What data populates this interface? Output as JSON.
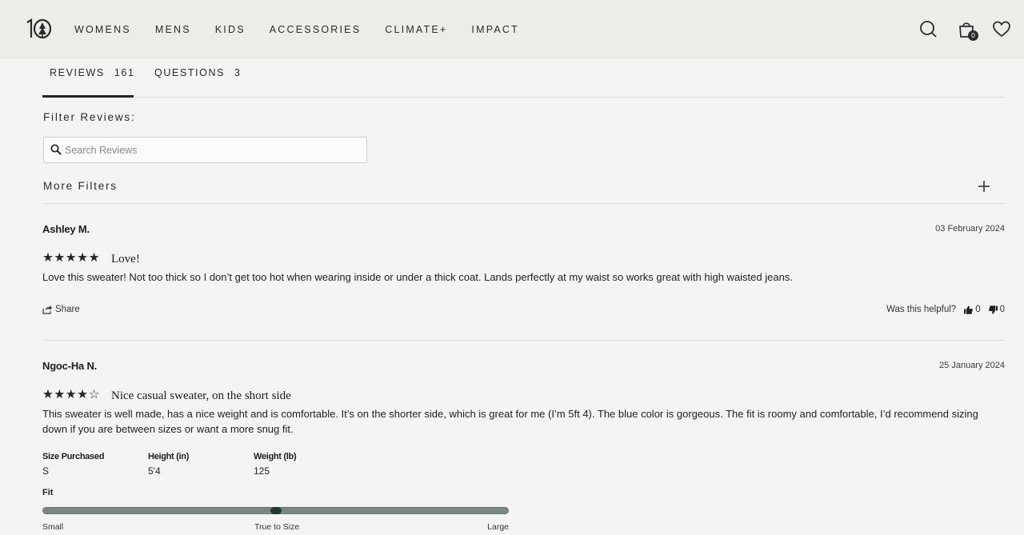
{
  "header": {
    "logo_alt": "10",
    "nav": [
      "WOMENS",
      "MENS",
      "KIDS",
      "ACCESSORIES",
      "CLIMATE+",
      "IMPACT"
    ],
    "cart_count": "0"
  },
  "tabs": [
    {
      "label": "REVIEWS",
      "count": "161"
    },
    {
      "label": "QUESTIONS",
      "count": "3"
    }
  ],
  "filters": {
    "title": "Filter Reviews:",
    "search_placeholder": "Search Reviews",
    "more_filters": "More Filters"
  },
  "reviews": [
    {
      "name": "Ashley M.",
      "date": "03 February 2024",
      "rating": 5,
      "stars": "★★★★★",
      "title": "Love!",
      "body": "Love this sweater! Not too thick so I don’t get too hot when wearing inside or under a thick coat. Lands perfectly at my waist so works great with high waisted jeans.",
      "share": "Share",
      "helpful_label": "Was this helpful?",
      "up": "0",
      "down": "0"
    },
    {
      "name": "Ngoc-Ha N.",
      "date": "25 January 2024",
      "rating": 4,
      "stars": "★★★★☆",
      "title": "Nice casual sweater, on the short side",
      "body": "This sweater is well made, has a nice weight and is comfortable. It’s on the shorter side, which is great for me (I’m 5ft 4). The blue color is gorgeous. The fit is roomy and comfortable, I’d recommend sizing down if you are between sizes or want a more snug fit.",
      "attributes": [
        {
          "key": "Size Purchased",
          "value": "S"
        },
        {
          "key": "Height (in)",
          "value": "5'4"
        },
        {
          "key": "Weight (lb)",
          "value": "125"
        }
      ],
      "fit": {
        "label": "Fit",
        "value": 0.5,
        "scale": [
          "Small",
          "True to Size",
          "Large"
        ]
      }
    }
  ],
  "colors": {
    "background": "#f4f4f2",
    "header": "#ecece9",
    "fit_bar": "#7b8781",
    "fit_knob": "#1f3a33"
  }
}
